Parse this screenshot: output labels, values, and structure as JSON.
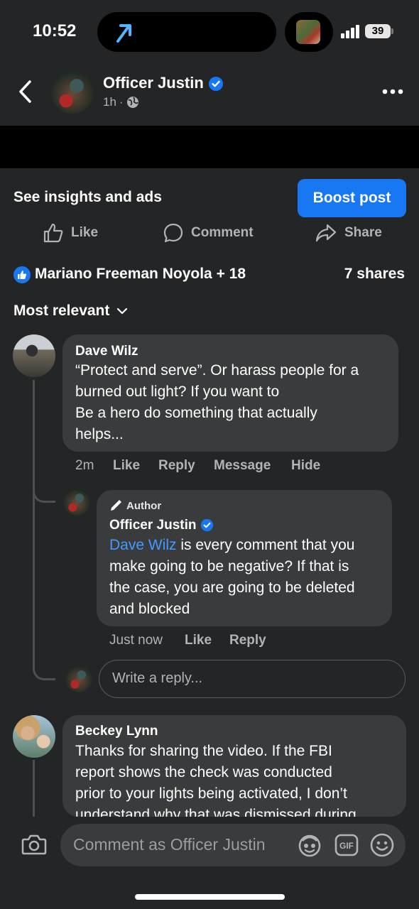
{
  "status_bar": {
    "time": "10:52",
    "battery": "39"
  },
  "header": {
    "name": "Officer Justin",
    "time_ago": "1h"
  },
  "post_actions": {
    "insights_label": "See insights and ads",
    "boost_label": "Boost post",
    "like_label": "Like",
    "comment_label": "Comment",
    "share_label": "Share"
  },
  "reactions": {
    "names": "Mariano Freeman Noyola + 18",
    "shares": "7 shares"
  },
  "sort_label": "Most relevant",
  "comments": [
    {
      "author": "Dave Wilz",
      "lines": [
        "“Protect and serve”. Or harass people for a",
        "burned out light? If you want to",
        "Be a hero do something that actually",
        "helps..."
      ],
      "time": "2m",
      "actions": [
        "Like",
        "Reply",
        "Message",
        "Hide"
      ]
    },
    {
      "tag": "Author",
      "author": "Officer Justin",
      "mention": "Dave Wilz",
      "lines": [
        " is every comment that you",
        "make going to be negative? If that is",
        "the case, you are going to be deleted",
        "and blocked"
      ],
      "time": "Just now",
      "actions": [
        "Like",
        "Reply"
      ]
    },
    {
      "author": "Beckey Lynn",
      "lines": [
        "Thanks for sharing the video. If the FBI",
        "report shows the check was conducted",
        "prior to your lights being activated, I don’t",
        "understand why that was dismissed during"
      ]
    }
  ],
  "reply_placeholder": "Write a reply...",
  "composer_placeholder": "Comment as Officer Justin",
  "colors": {
    "accent": "#1877f2",
    "link": "#4599ff",
    "background": "#242526",
    "bubble": "#3a3b3c"
  },
  "icons": [
    "back-arrow-icon",
    "verified-badge-icon",
    "globe-icon",
    "more-icon",
    "thumbs-up-icon",
    "comment-icon",
    "share-icon",
    "like-reaction-icon",
    "chevron-down-icon",
    "pencil-icon",
    "camera-icon",
    "avatar-sticker-icon",
    "gif-icon",
    "emoji-icon",
    "location-arrow-icon"
  ]
}
